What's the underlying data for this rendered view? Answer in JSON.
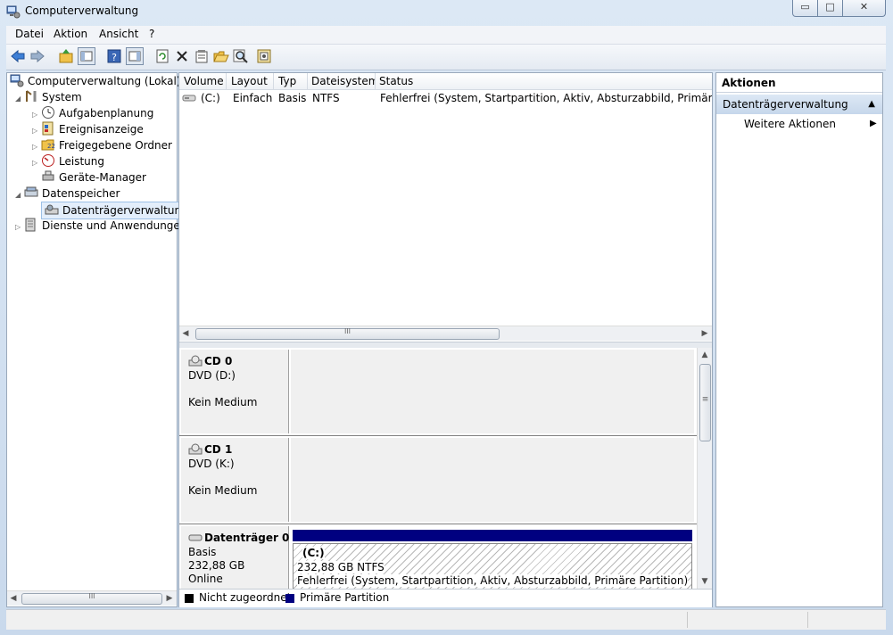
{
  "window": {
    "title": "Computerverwaltung",
    "controls": {
      "minimize": "▭",
      "maximize": "□",
      "close": "✕"
    }
  },
  "menu": [
    "Datei",
    "Aktion",
    "Ansicht",
    "?"
  ],
  "tree": {
    "root": "Computerverwaltung (Lokal)",
    "system": "System",
    "aufgaben": "Aufgabenplanung",
    "ereignis": "Ereignisanzeige",
    "freigegeben": "Freigegebene Ordner",
    "leistung": "Leistung",
    "geraete": "Geräte-Manager",
    "datenspeicher": "Datenspeicher",
    "datentraeger": "Datenträgerverwaltung",
    "dienste": "Dienste und Anwendungen"
  },
  "volume_list": {
    "columns": [
      "Volume",
      "Layout",
      "Typ",
      "Dateisystem",
      "Status"
    ],
    "rows": [
      {
        "volume": "(C:)",
        "layout": "Einfach",
        "typ": "Basis",
        "dateisystem": "NTFS",
        "status": "Fehlerfrei (System, Startpartition, Aktiv, Absturzabbild, Primäre Partition)"
      }
    ]
  },
  "disks": [
    {
      "name": "CD 0",
      "type": "DVD (D:)",
      "state": "Kein Medium"
    },
    {
      "name": "CD 1",
      "type": "DVD (K:)",
      "state": "Kein Medium"
    },
    {
      "name": "Datenträger 0",
      "type": "Basis",
      "size": "232,88 GB",
      "state": "Online",
      "partition": {
        "label": "(C:)",
        "size_fs": "232,88 GB NTFS",
        "status": "Fehlerfrei (System, Startpartition, Aktiv, Absturzabbild, Primäre Partition)"
      }
    }
  ],
  "legend": [
    {
      "label": "Nicht zugeordnet",
      "color": "#000000"
    },
    {
      "label": "Primäre Partition",
      "color": "#000080"
    }
  ],
  "actions": {
    "header": "Aktionen",
    "section": "Datenträgerverwaltung",
    "item": "Weitere Aktionen"
  },
  "scrollbar_grip": "III",
  "vscroll_grip": "≡"
}
